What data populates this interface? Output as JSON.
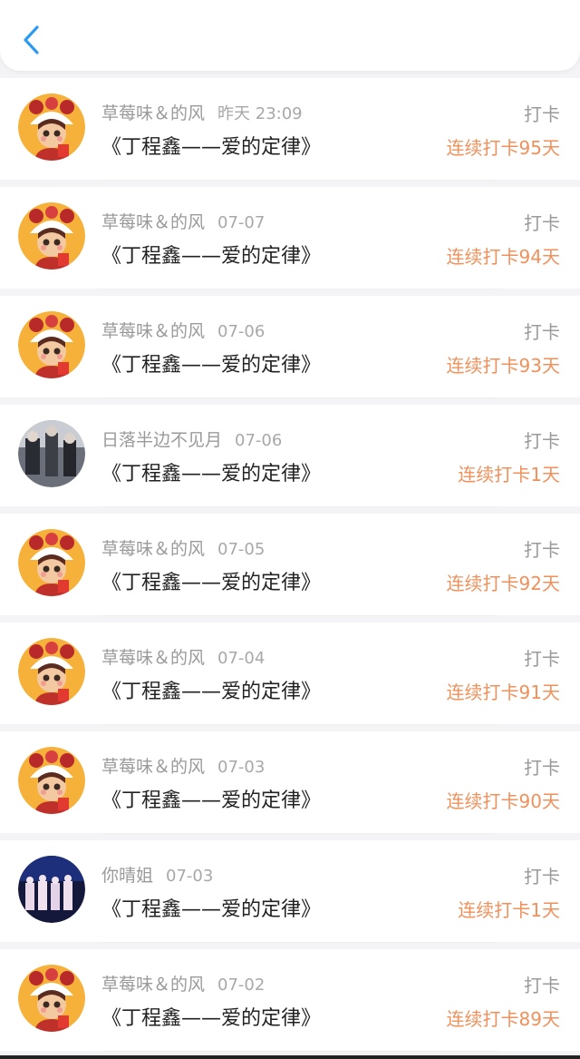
{
  "header": {
    "back_icon": "chevron-left-icon",
    "accent": "#2f9bf0"
  },
  "items": [
    {
      "name": "草莓味＆的风",
      "date": "昨天 23:09",
      "title": "《丁程鑫——爱的定律》",
      "action": "打卡",
      "streak": "连续打卡95天",
      "avatar": "doll"
    },
    {
      "name": "草莓味＆的风",
      "date": "07-07",
      "title": "《丁程鑫——爱的定律》",
      "action": "打卡",
      "streak": "连续打卡94天",
      "avatar": "doll"
    },
    {
      "name": "草莓味＆的风",
      "date": "07-06",
      "title": "《丁程鑫——爱的定律》",
      "action": "打卡",
      "streak": "连续打卡93天",
      "avatar": "doll"
    },
    {
      "name": "日落半边不见月",
      "date": "07-06",
      "title": "《丁程鑫——爱的定律》",
      "action": "打卡",
      "streak": "连续打卡1天",
      "avatar": "photo"
    },
    {
      "name": "草莓味＆的风",
      "date": "07-05",
      "title": "《丁程鑫——爱的定律》",
      "action": "打卡",
      "streak": "连续打卡92天",
      "avatar": "doll"
    },
    {
      "name": "草莓味＆的风",
      "date": "07-04",
      "title": "《丁程鑫——爱的定律》",
      "action": "打卡",
      "streak": "连续打卡91天",
      "avatar": "doll"
    },
    {
      "name": "草莓味＆的风",
      "date": "07-03",
      "title": "《丁程鑫——爱的定律》",
      "action": "打卡",
      "streak": "连续打卡90天",
      "avatar": "doll"
    },
    {
      "name": "你晴姐",
      "date": "07-03",
      "title": "《丁程鑫——爱的定律》",
      "action": "打卡",
      "streak": "连续打卡1天",
      "avatar": "stage"
    },
    {
      "name": "草莓味＆的风",
      "date": "07-02",
      "title": "《丁程鑫——爱的定律》",
      "action": "打卡",
      "streak": "连续打卡89天",
      "avatar": "doll"
    }
  ]
}
